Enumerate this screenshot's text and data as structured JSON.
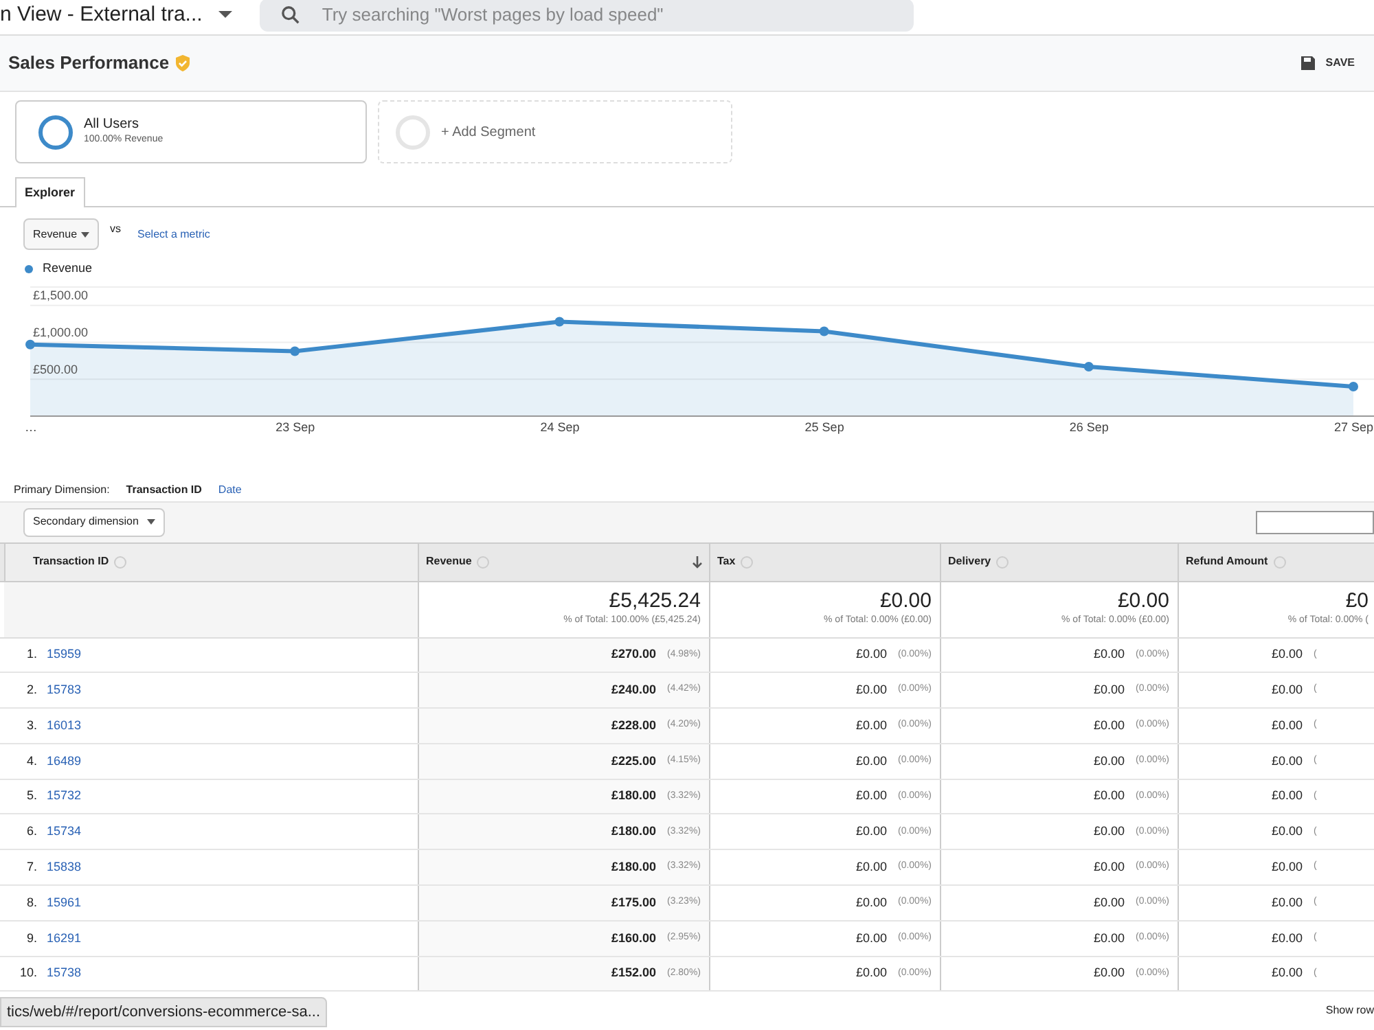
{
  "topbar": {
    "view_title": "n View - External tra...",
    "search": {
      "placeholder": "Try searching \"Worst pages by load speed\""
    }
  },
  "report": {
    "title": "Sales Performance",
    "save": "SAVE"
  },
  "segments": [
    {
      "kind": "segment",
      "name": "All Users",
      "detail": "100.00% Revenue"
    },
    {
      "kind": "add",
      "name": "+ Add Segment"
    }
  ],
  "tabs": [
    {
      "label": "Explorer",
      "selected": true
    }
  ],
  "metric": {
    "value": "Revenue",
    "vs": "vs",
    "select": "Select a metric"
  },
  "chart": {
    "chart_data": {
      "type": "area",
      "grid": true,
      "categories": [
        "…",
        "23 Sep",
        "24 Sep",
        "25 Sep",
        "26 Sep",
        "27 Sep"
      ],
      "series": [
        {
          "name": "Revenue",
          "color": "#3d8ac9",
          "values": [
            970,
            880,
            1280,
            1150,
            670,
            400
          ]
        }
      ],
      "ylim": [
        0,
        1750
      ],
      "yticks": [
        {
          "value": 500,
          "label": "£500.00"
        },
        {
          "value": 1000,
          "label": "£1,000.00"
        },
        {
          "value": 1500,
          "label": "£1,500.00"
        }
      ]
    }
  },
  "primary_dimension": {
    "label": "Primary Dimension:",
    "options": [
      {
        "label": "Transaction ID",
        "selected": true
      },
      {
        "label": "Date",
        "selected": false
      }
    ]
  },
  "secondary_dimension": "Secondary dimension",
  "table": {
    "columns": [
      {
        "label": "Transaction ID",
        "sorted": false
      },
      {
        "label": "Revenue",
        "sorted": true
      },
      {
        "label": "Tax",
        "sorted": false
      },
      {
        "label": "Delivery",
        "sorted": false
      },
      {
        "label": "Refund Amount",
        "sorted": false
      }
    ],
    "totals": [
      {
        "value": "£5,425.24",
        "detail": "% of Total: 100.00% (£5,425.24)"
      },
      {
        "value": "£0.00",
        "detail": "% of Total: 0.00% (£0.00)"
      },
      {
        "value": "£0.00",
        "detail": "% of Total: 0.00% (£0.00)"
      },
      {
        "value": "£0",
        "detail": "% of Total: 0.00% ("
      }
    ],
    "rows": [
      {
        "index": "1.",
        "id": "15959",
        "cells": [
          [
            "£270.00",
            "(4.98%)"
          ],
          [
            "£0.00",
            "(0.00%)"
          ],
          [
            "£0.00",
            "(0.00%)"
          ],
          [
            "£0.00",
            "("
          ]
        ]
      },
      {
        "index": "2.",
        "id": "15783",
        "cells": [
          [
            "£240.00",
            "(4.42%)"
          ],
          [
            "£0.00",
            "(0.00%)"
          ],
          [
            "£0.00",
            "(0.00%)"
          ],
          [
            "£0.00",
            "("
          ]
        ]
      },
      {
        "index": "3.",
        "id": "16013",
        "cells": [
          [
            "£228.00",
            "(4.20%)"
          ],
          [
            "£0.00",
            "(0.00%)"
          ],
          [
            "£0.00",
            "(0.00%)"
          ],
          [
            "£0.00",
            "("
          ]
        ]
      },
      {
        "index": "4.",
        "id": "16489",
        "cells": [
          [
            "£225.00",
            "(4.15%)"
          ],
          [
            "£0.00",
            "(0.00%)"
          ],
          [
            "£0.00",
            "(0.00%)"
          ],
          [
            "£0.00",
            "("
          ]
        ]
      },
      {
        "index": "5.",
        "id": "15732",
        "cells": [
          [
            "£180.00",
            "(3.32%)"
          ],
          [
            "£0.00",
            "(0.00%)"
          ],
          [
            "£0.00",
            "(0.00%)"
          ],
          [
            "£0.00",
            "("
          ]
        ]
      },
      {
        "index": "6.",
        "id": "15734",
        "cells": [
          [
            "£180.00",
            "(3.32%)"
          ],
          [
            "£0.00",
            "(0.00%)"
          ],
          [
            "£0.00",
            "(0.00%)"
          ],
          [
            "£0.00",
            "("
          ]
        ]
      },
      {
        "index": "7.",
        "id": "15838",
        "cells": [
          [
            "£180.00",
            "(3.32%)"
          ],
          [
            "£0.00",
            "(0.00%)"
          ],
          [
            "£0.00",
            "(0.00%)"
          ],
          [
            "£0.00",
            "("
          ]
        ]
      },
      {
        "index": "8.",
        "id": "15961",
        "cells": [
          [
            "£175.00",
            "(3.23%)"
          ],
          [
            "£0.00",
            "(0.00%)"
          ],
          [
            "£0.00",
            "(0.00%)"
          ],
          [
            "£0.00",
            "("
          ]
        ]
      },
      {
        "index": "9.",
        "id": "16291",
        "cells": [
          [
            "£160.00",
            "(2.95%)"
          ],
          [
            "£0.00",
            "(0.00%)"
          ],
          [
            "£0.00",
            "(0.00%)"
          ],
          [
            "£0.00",
            "("
          ]
        ]
      },
      {
        "index": "10.",
        "id": "15738",
        "cells": [
          [
            "£152.00",
            "(2.80%)"
          ],
          [
            "£0.00",
            "(0.00%)"
          ],
          [
            "£0.00",
            "(0.00%)"
          ],
          [
            "£0.00",
            "("
          ]
        ]
      }
    ]
  },
  "status_url": "tics/web/#/report/conversions-ecommerce-sa...",
  "show_rows": "Show row"
}
